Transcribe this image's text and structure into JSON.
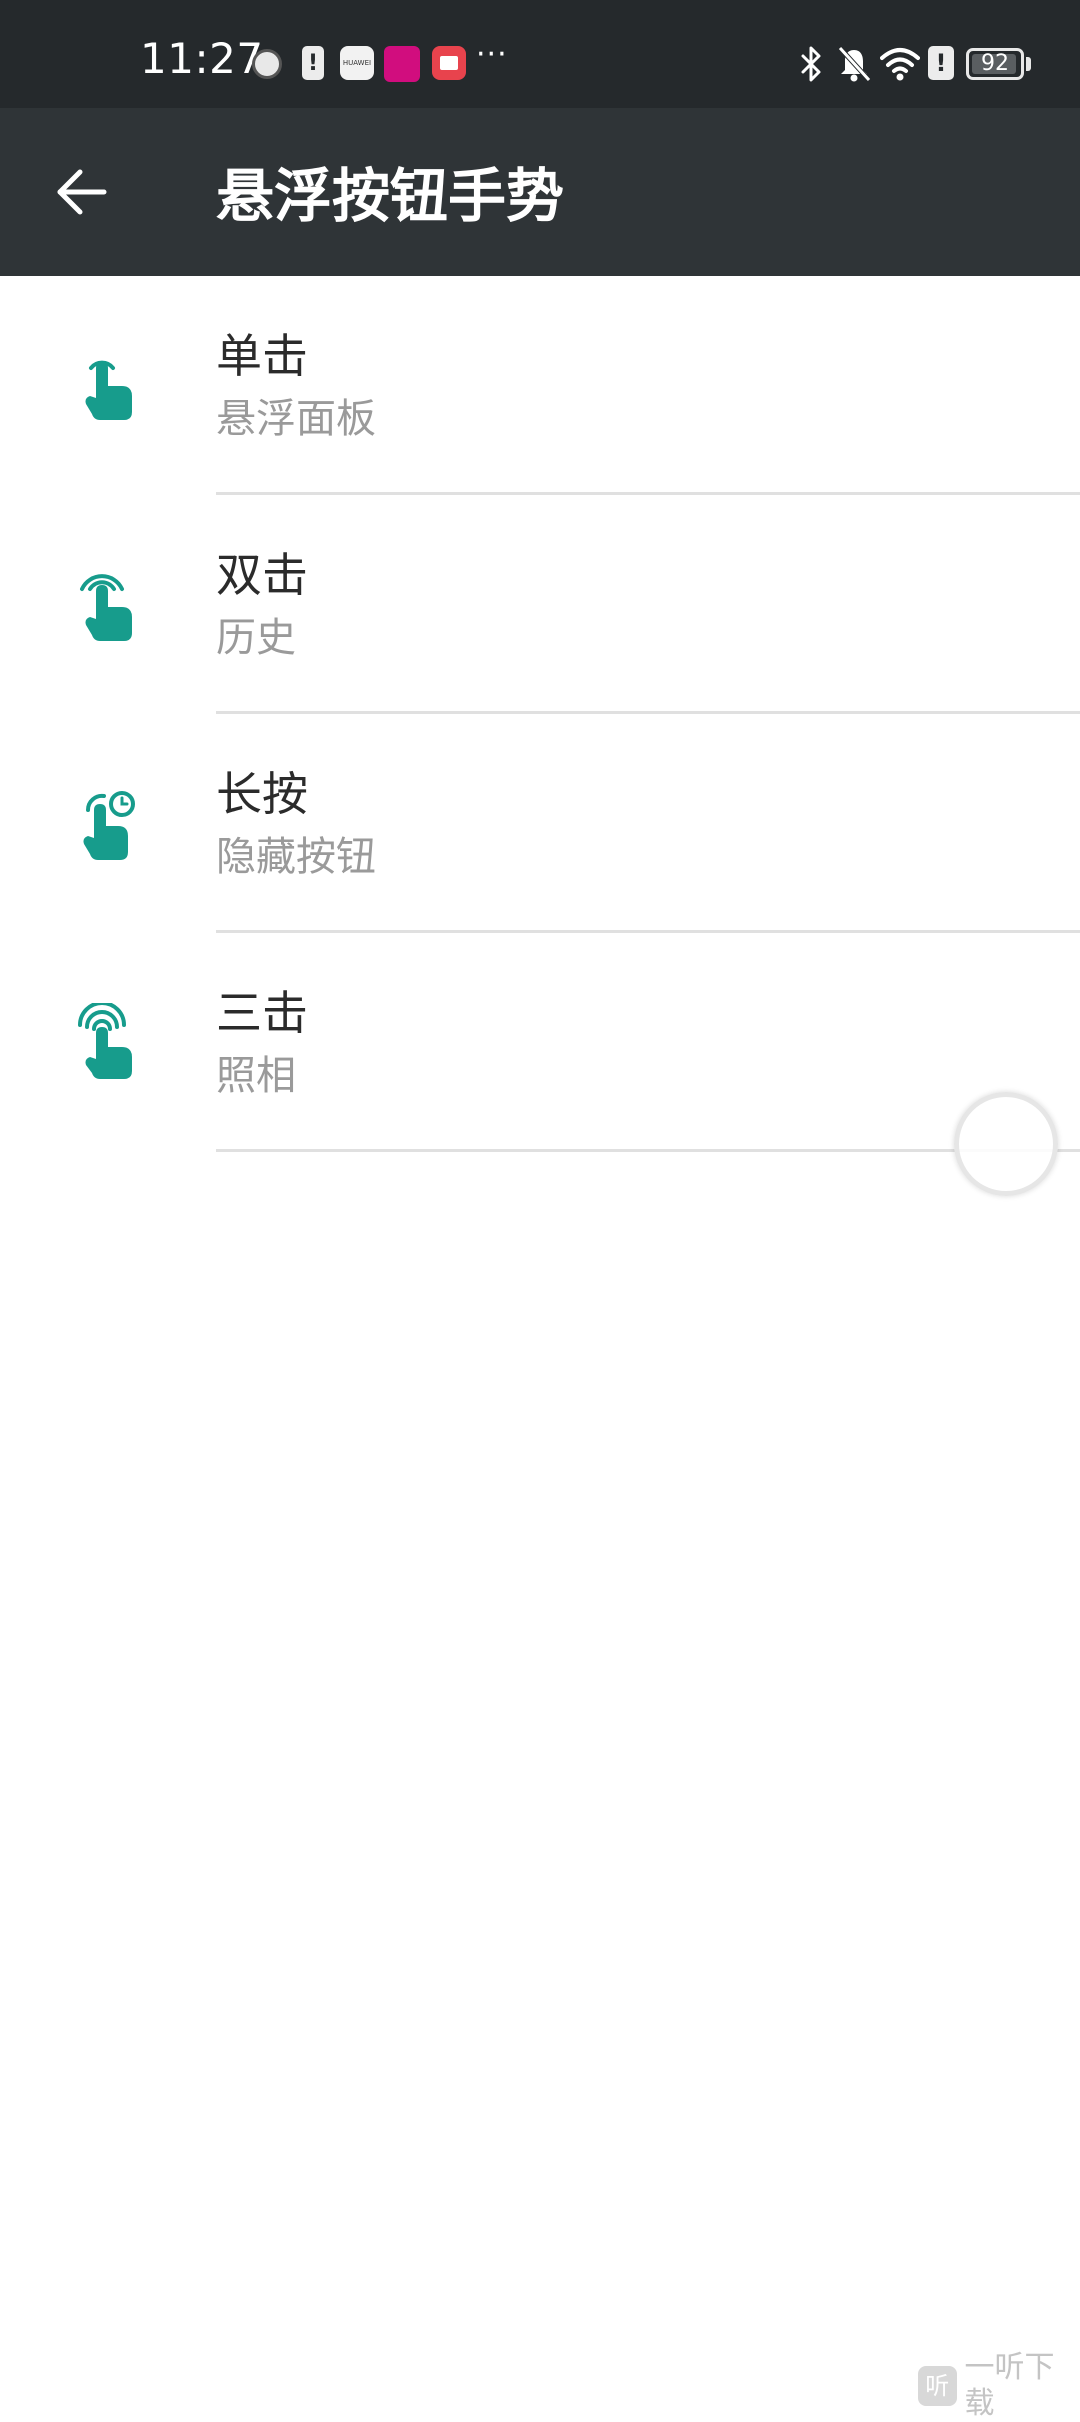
{
  "status_bar": {
    "time": "11:27",
    "notification_icons": [
      "record-dot-icon",
      "alert-icon",
      "huawei-appgallery-icon",
      "vip-shop-icon",
      "book-app-icon"
    ],
    "huawei_label": "HUAWEI",
    "more_label": "···",
    "bluetooth_icon": "bluetooth-icon",
    "silent_icon": "bell-off-icon",
    "wifi_icon": "wifi-icon",
    "alert_label": "!",
    "battery_level": "92"
  },
  "app_bar": {
    "back_icon": "arrow-back-icon",
    "title": "悬浮按钮手势"
  },
  "gestures": [
    {
      "title": "单击",
      "subtitle": "悬浮面板",
      "icon": "tap-icon"
    },
    {
      "title": "双击",
      "subtitle": "历史",
      "icon": "double-tap-icon"
    },
    {
      "title": "长按",
      "subtitle": "隐藏按钮",
      "icon": "long-press-icon"
    },
    {
      "title": "三击",
      "subtitle": "照相",
      "icon": "triple-tap-icon"
    }
  ],
  "floating_button": {
    "icon": "floating-circle"
  },
  "watermark": {
    "logo": "听",
    "text": "一听下载"
  },
  "colors": {
    "status_bar_bg": "#25292c",
    "app_bar_bg": "#2f3437",
    "accent": "#179c8c",
    "title_text": "#2b2b2b",
    "subtitle_text": "#9a9a9a",
    "divider": "#e0e0e0"
  }
}
